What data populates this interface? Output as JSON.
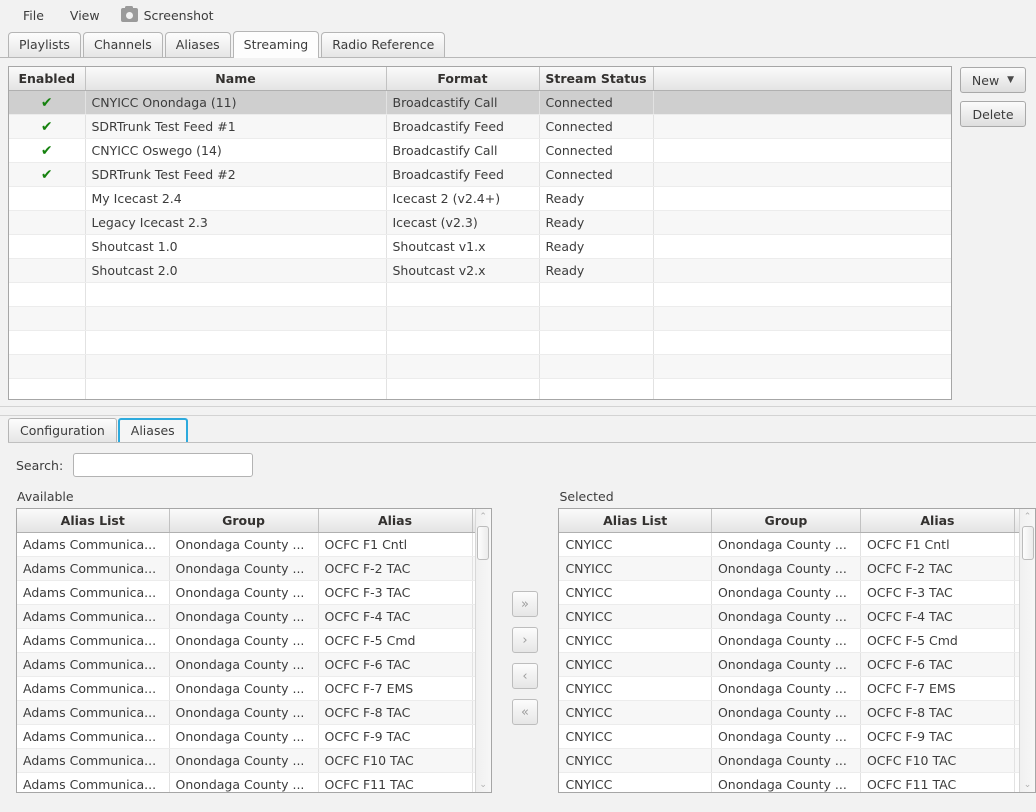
{
  "menubar": {
    "items": [
      {
        "label": "File",
        "icon": null
      },
      {
        "label": "View",
        "icon": null
      },
      {
        "label": "Screenshot",
        "icon": "camera-icon"
      }
    ]
  },
  "main_tabs": {
    "items": [
      {
        "label": "Playlists",
        "active": false
      },
      {
        "label": "Channels",
        "active": false
      },
      {
        "label": "Aliases",
        "active": false
      },
      {
        "label": "Streaming",
        "active": true
      },
      {
        "label": "Radio Reference",
        "active": false
      }
    ]
  },
  "streaming_table": {
    "columns": [
      "Enabled",
      "Name",
      "Format",
      "Stream Status",
      ""
    ],
    "rows": [
      {
        "enabled": "✔",
        "name": "CNYICC Onondaga (11)",
        "format": "Broadcastify Call",
        "status": "Connected",
        "selected": true
      },
      {
        "enabled": "✔",
        "name": "SDRTrunk Test Feed #1",
        "format": "Broadcastify Feed",
        "status": "Connected",
        "selected": false
      },
      {
        "enabled": "✔",
        "name": "CNYICC Oswego (14)",
        "format": "Broadcastify Call",
        "status": "Connected",
        "selected": false
      },
      {
        "enabled": "✔",
        "name": "SDRTrunk Test Feed #2",
        "format": "Broadcastify Feed",
        "status": "Connected",
        "selected": false
      },
      {
        "enabled": "",
        "name": "My Icecast 2.4",
        "format": "Icecast 2 (v2.4+)",
        "status": "Ready",
        "selected": false
      },
      {
        "enabled": "",
        "name": "Legacy Icecast 2.3",
        "format": "Icecast (v2.3)",
        "status": "Ready",
        "selected": false
      },
      {
        "enabled": "",
        "name": "Shoutcast 1.0",
        "format": "Shoutcast v1.x",
        "status": "Ready",
        "selected": false
      },
      {
        "enabled": "",
        "name": "Shoutcast 2.0",
        "format": "Shoutcast v2.x",
        "status": "Ready",
        "selected": false
      },
      {
        "enabled": "",
        "name": "",
        "format": "",
        "status": "",
        "selected": false
      },
      {
        "enabled": "",
        "name": "",
        "format": "",
        "status": "",
        "selected": false
      },
      {
        "enabled": "",
        "name": "",
        "format": "",
        "status": "",
        "selected": false
      },
      {
        "enabled": "",
        "name": "",
        "format": "",
        "status": "",
        "selected": false
      },
      {
        "enabled": "",
        "name": "",
        "format": "",
        "status": "",
        "selected": false
      }
    ]
  },
  "actions": {
    "new_label": "New",
    "new_caret": "▼",
    "delete_label": "Delete"
  },
  "bottom_tabs": {
    "items": [
      {
        "label": "Configuration",
        "active": false
      },
      {
        "label": "Aliases",
        "active": true
      }
    ]
  },
  "search": {
    "label": "Search:",
    "value": "",
    "placeholder": ""
  },
  "available": {
    "title": "Available",
    "columns": [
      "Alias List",
      "Group",
      "Alias",
      ""
    ],
    "rows": [
      {
        "list": "Adams Communica...",
        "group": "Onondaga County ...",
        "alias": "OCFC F1 Cntl"
      },
      {
        "list": "Adams Communica...",
        "group": "Onondaga County ...",
        "alias": "OCFC F-2 TAC"
      },
      {
        "list": "Adams Communica...",
        "group": "Onondaga County ...",
        "alias": "OCFC F-3 TAC"
      },
      {
        "list": "Adams Communica...",
        "group": "Onondaga County ...",
        "alias": "OCFC F-4 TAC"
      },
      {
        "list": "Adams Communica...",
        "group": "Onondaga County ...",
        "alias": "OCFC F-5 Cmd"
      },
      {
        "list": "Adams Communica...",
        "group": "Onondaga County ...",
        "alias": "OCFC F-6 TAC"
      },
      {
        "list": "Adams Communica...",
        "group": "Onondaga County ...",
        "alias": "OCFC F-7 EMS"
      },
      {
        "list": "Adams Communica...",
        "group": "Onondaga County ...",
        "alias": "OCFC F-8 TAC"
      },
      {
        "list": "Adams Communica...",
        "group": "Onondaga County ...",
        "alias": "OCFC F-9 TAC"
      },
      {
        "list": "Adams Communica...",
        "group": "Onondaga County ...",
        "alias": "OCFC F10 TAC"
      },
      {
        "list": "Adams Communica...",
        "group": "Onondaga County ...",
        "alias": "OCFC F11 TAC"
      }
    ]
  },
  "selected": {
    "title": "Selected",
    "columns": [
      "Alias List",
      "Group",
      "Alias",
      ""
    ],
    "rows": [
      {
        "list": "CNYICC",
        "group": "Onondaga County ...",
        "alias": "OCFC F1 Cntl"
      },
      {
        "list": "CNYICC",
        "group": "Onondaga County ...",
        "alias": "OCFC F-2 TAC"
      },
      {
        "list": "CNYICC",
        "group": "Onondaga County ...",
        "alias": "OCFC F-3 TAC"
      },
      {
        "list": "CNYICC",
        "group": "Onondaga County ...",
        "alias": "OCFC F-4 TAC"
      },
      {
        "list": "CNYICC",
        "group": "Onondaga County ...",
        "alias": "OCFC F-5 Cmd"
      },
      {
        "list": "CNYICC",
        "group": "Onondaga County ...",
        "alias": "OCFC F-6 TAC"
      },
      {
        "list": "CNYICC",
        "group": "Onondaga County ...",
        "alias": "OCFC F-7 EMS"
      },
      {
        "list": "CNYICC",
        "group": "Onondaga County ...",
        "alias": "OCFC F-8 TAC"
      },
      {
        "list": "CNYICC",
        "group": "Onondaga County ...",
        "alias": "OCFC F-9 TAC"
      },
      {
        "list": "CNYICC",
        "group": "Onondaga County ...",
        "alias": "OCFC F10 TAC"
      },
      {
        "list": "CNYICC",
        "group": "Onondaga County ...",
        "alias": "OCFC F11 TAC"
      }
    ]
  },
  "transfer_buttons": [
    {
      "name": "move-all-right-button",
      "glyph": "»"
    },
    {
      "name": "move-right-button",
      "glyph": "›"
    },
    {
      "name": "move-left-button",
      "glyph": "‹"
    },
    {
      "name": "move-all-left-button",
      "glyph": "«"
    }
  ],
  "scrollbars": {
    "up_glyph": "⌃",
    "down_glyph": "⌄"
  },
  "colors": {
    "accent": "#2daadd",
    "check_green": "#16820f",
    "selection_gray": "#cfcfcf",
    "window_bg": "#f2f2f2"
  }
}
